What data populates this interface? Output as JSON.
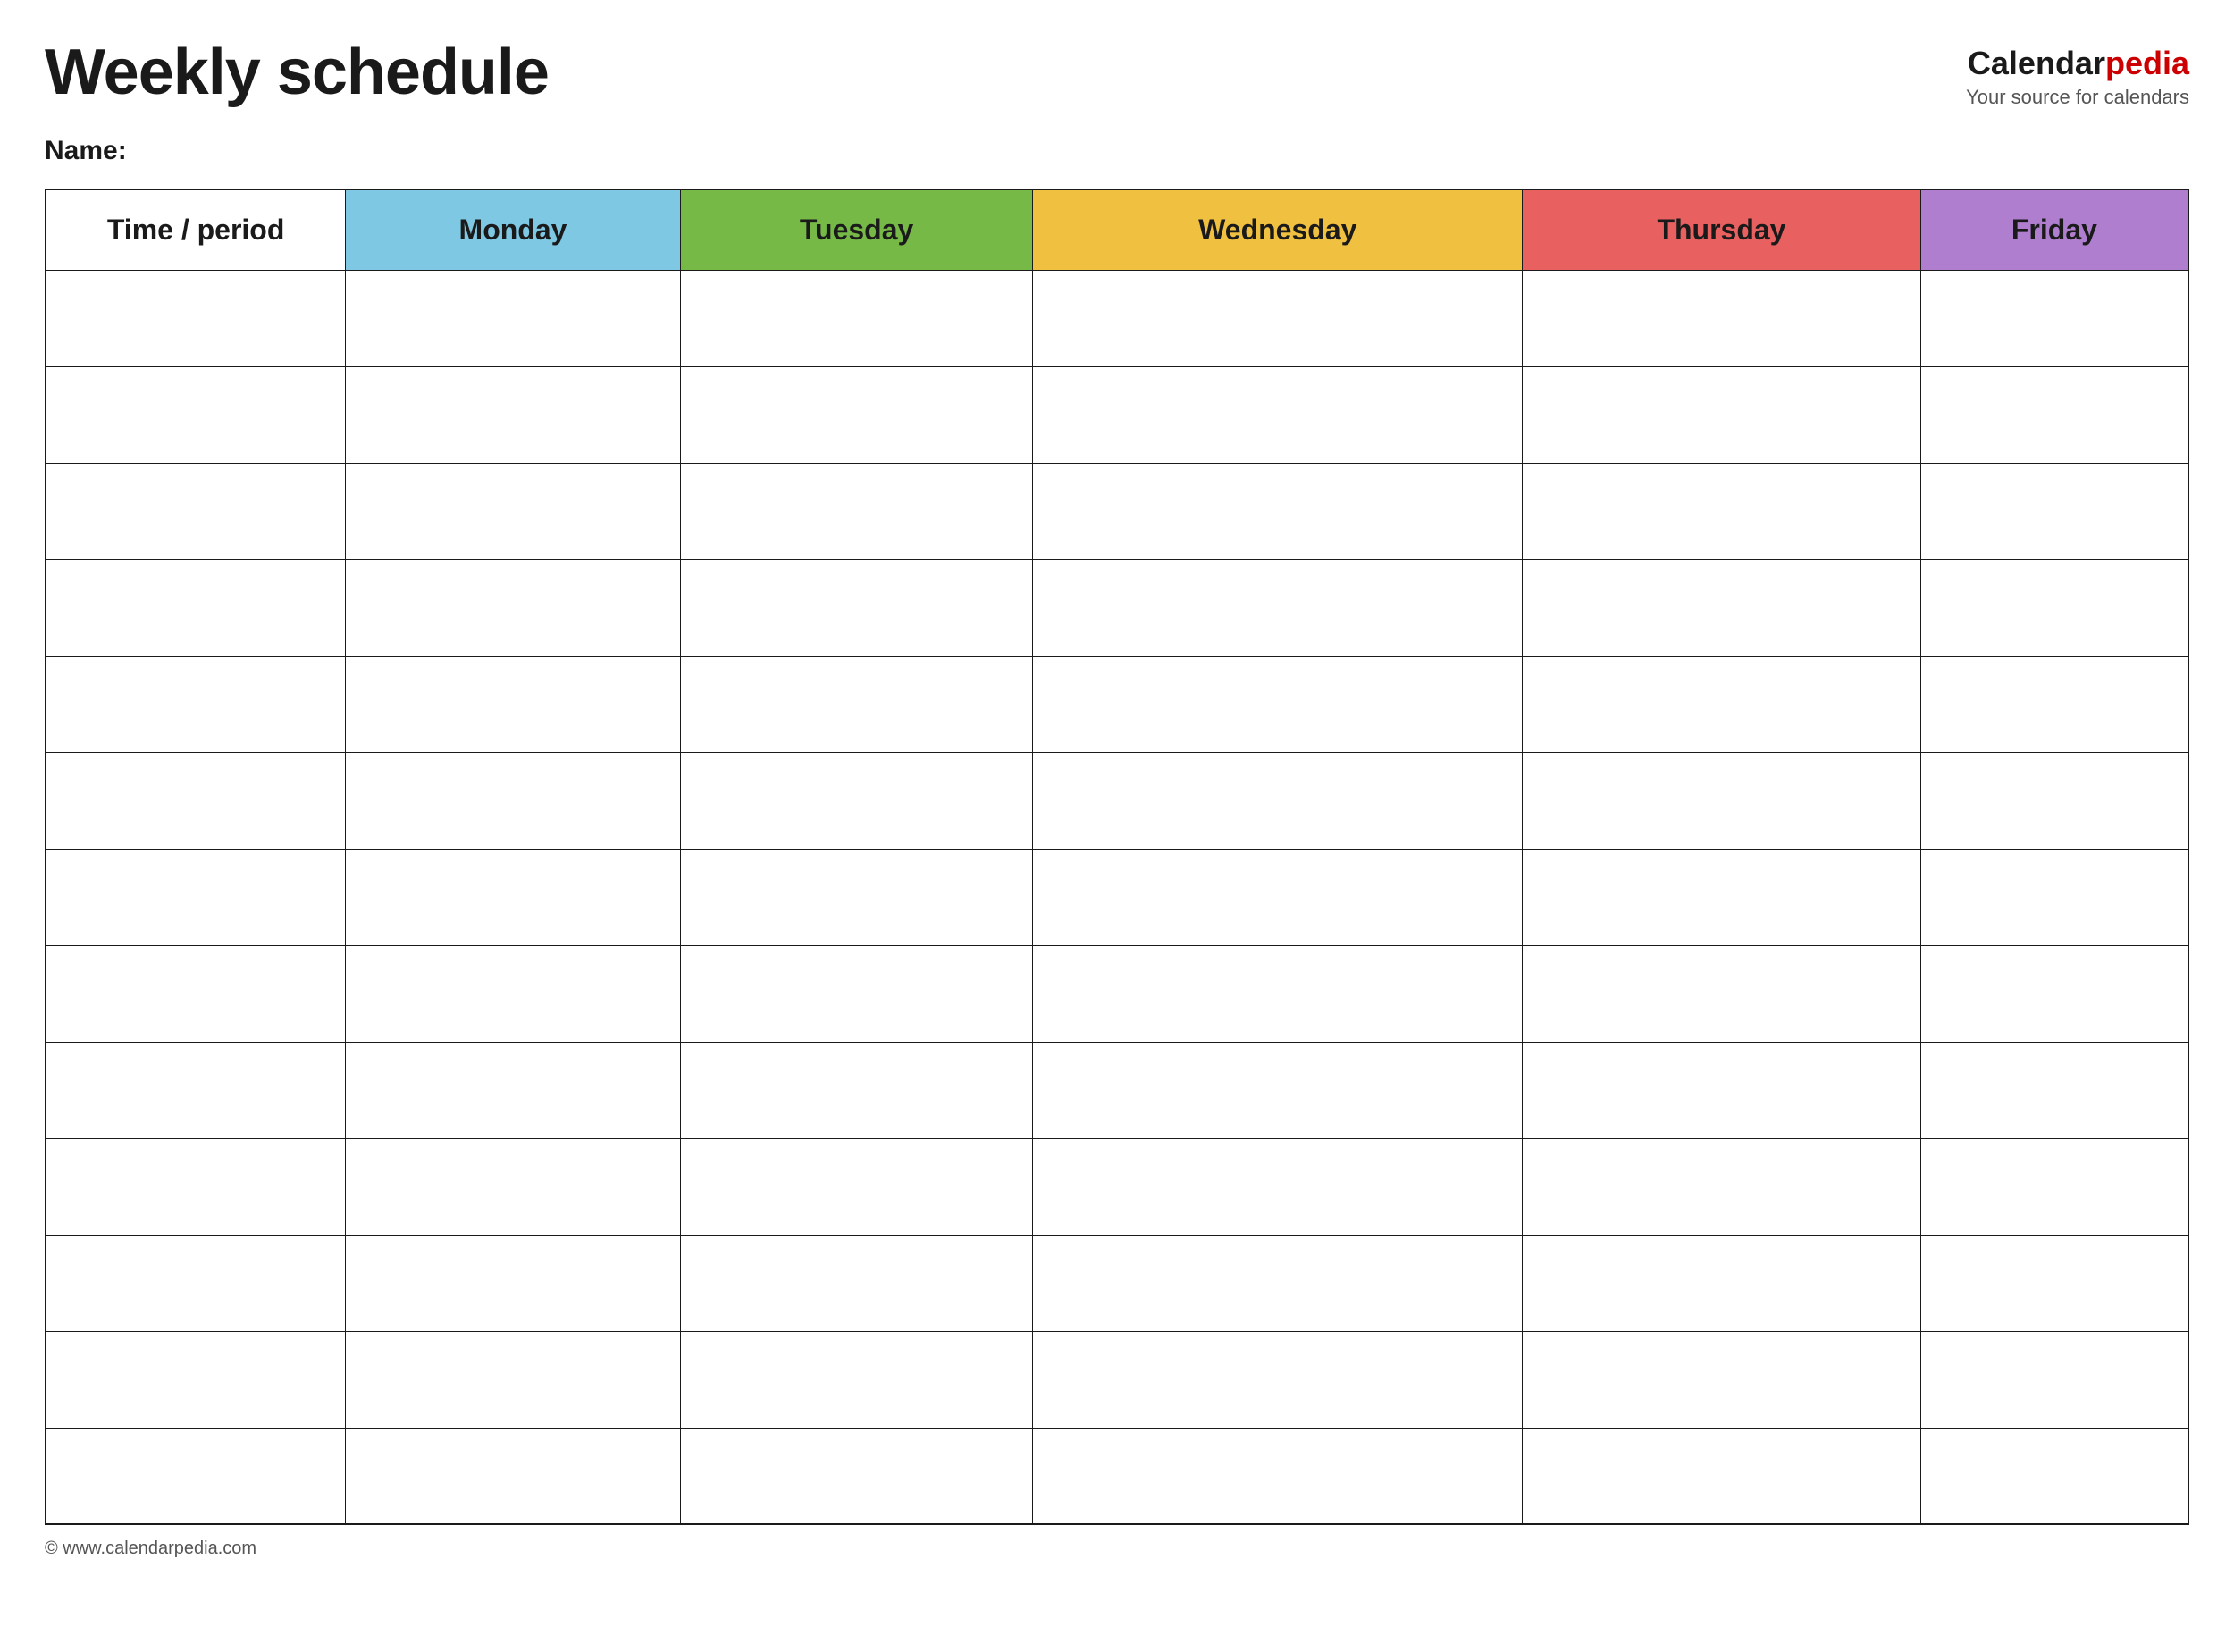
{
  "header": {
    "title": "Weekly schedule",
    "logo": {
      "calendar": "Calendar",
      "pedia": "pedia",
      "tagline": "Your source for calendars"
    }
  },
  "name_label": "Name:",
  "columns": [
    {
      "id": "time",
      "label": "Time / period",
      "color": "#ffffff"
    },
    {
      "id": "monday",
      "label": "Monday",
      "color": "#7ec8e3"
    },
    {
      "id": "tuesday",
      "label": "Tuesday",
      "color": "#76b947"
    },
    {
      "id": "wednesday",
      "label": "Wednesday",
      "color": "#f0c040"
    },
    {
      "id": "thursday",
      "label": "Thursday",
      "color": "#e86060"
    },
    {
      "id": "friday",
      "label": "Friday",
      "color": "#b07ecf"
    }
  ],
  "rows": [
    [
      "",
      "",
      "",
      "",
      "",
      ""
    ],
    [
      "",
      "",
      "",
      "",
      "",
      ""
    ],
    [
      "",
      "",
      "",
      "",
      "",
      ""
    ],
    [
      "",
      "",
      "",
      "",
      "",
      ""
    ],
    [
      "",
      "",
      "",
      "",
      "",
      ""
    ],
    [
      "",
      "",
      "",
      "",
      "",
      ""
    ],
    [
      "",
      "",
      "",
      "",
      "",
      ""
    ],
    [
      "",
      "",
      "",
      "",
      "",
      ""
    ],
    [
      "",
      "",
      "",
      "",
      "",
      ""
    ],
    [
      "",
      "",
      "",
      "",
      "",
      ""
    ],
    [
      "",
      "",
      "",
      "",
      "",
      ""
    ],
    [
      "",
      "",
      "",
      "",
      "",
      ""
    ],
    [
      "",
      "",
      "",
      "",
      "",
      ""
    ]
  ],
  "footer": {
    "copyright": "© www.calendarpedia.com"
  }
}
